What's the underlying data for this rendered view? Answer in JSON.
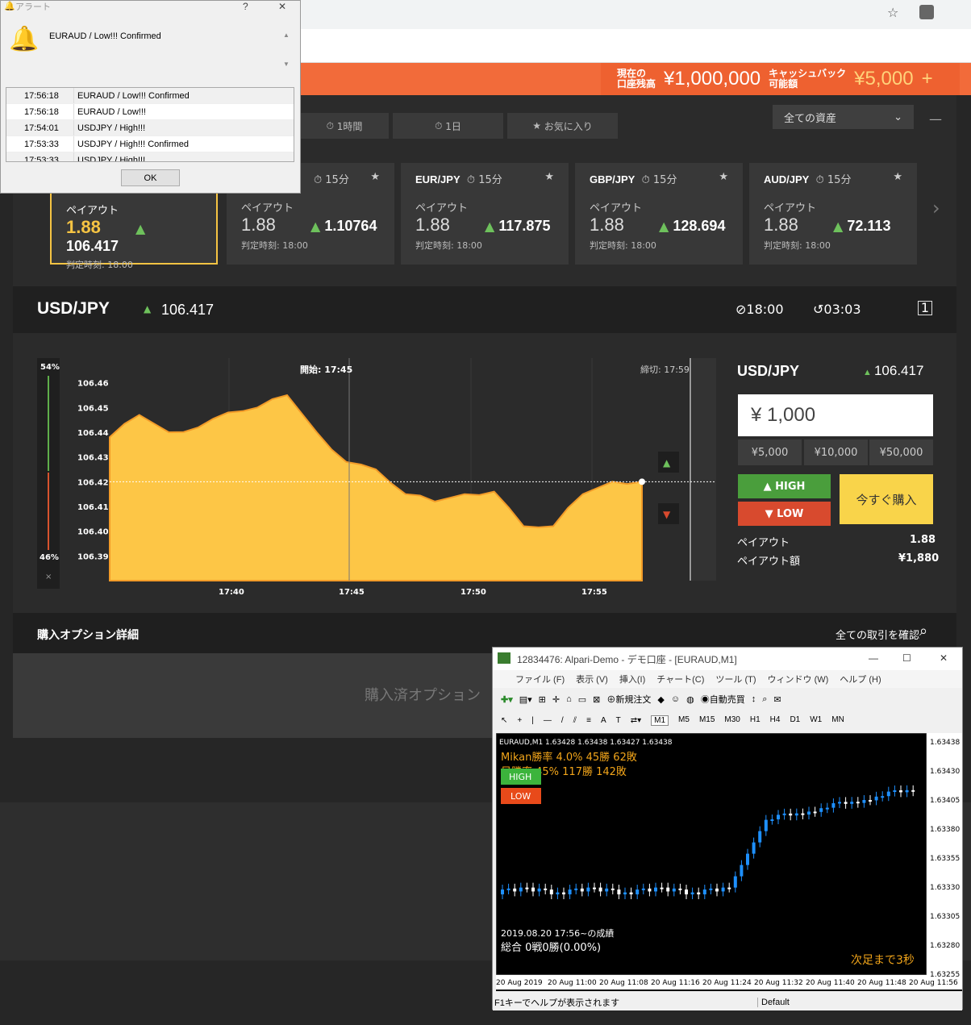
{
  "header": {
    "balance_label": "現在の\n口座残高",
    "balance_value": "¥1,000,000",
    "cashback_label": "キャッシュバック\n可能額",
    "cashback_value": "¥5,000",
    "plus": "+"
  },
  "tabs": [
    "1時間",
    "1日",
    "お気に入り"
  ],
  "asset_select": "全ての資産",
  "cards": [
    {
      "pair": "",
      "period": "15分",
      "payout_label": "ペイアウト",
      "payout": "1.88",
      "price": "106.417",
      "time": "判定時刻: 18:00"
    },
    {
      "pair": "",
      "period": "15分",
      "payout_label": "ペイアウト",
      "payout": "1.88",
      "price": "1.10764",
      "time": "判定時刻: 18:00"
    },
    {
      "pair": "EUR/JPY",
      "period": "15分",
      "payout_label": "ペイアウト",
      "payout": "1.88",
      "price": "117.875",
      "time": "判定時刻: 18:00"
    },
    {
      "pair": "GBP/JPY",
      "period": "15分",
      "payout_label": "ペイアウト",
      "payout": "1.88",
      "price": "128.694",
      "time": "判定時刻: 18:00"
    },
    {
      "pair": "AUD/JPY",
      "period": "15分",
      "payout_label": "ペイアウト",
      "payout": "1.88",
      "price": "72.113",
      "time": "判定時刻: 18:00"
    }
  ],
  "pair_row": {
    "pair": "USD/JPY",
    "price": "106.417",
    "end_time": "18:00",
    "remaining": "03:03"
  },
  "chart": {
    "pct_high": "54%",
    "pct_low": "46%",
    "close": "×",
    "start_label": "開始: 17:45",
    "end_label": "締切: 17:59",
    "yticks": [
      "106.46",
      "106.45",
      "106.44",
      "106.43",
      "106.42",
      "106.41",
      "106.40",
      "106.39"
    ],
    "xticks": [
      "17:40",
      "17:45",
      "17:50",
      "17:55"
    ]
  },
  "chart_data": {
    "type": "area",
    "x": [
      "17:38",
      "17:39",
      "17:40",
      "17:41",
      "17:42",
      "17:43",
      "17:44",
      "17:45",
      "17:46",
      "17:47",
      "17:48",
      "17:49",
      "17:50",
      "17:51",
      "17:52",
      "17:53",
      "17:54",
      "17:55",
      "17:56"
    ],
    "values": [
      106.438,
      106.447,
      106.44,
      106.442,
      106.448,
      106.45,
      106.455,
      106.44,
      106.428,
      106.425,
      106.415,
      106.412,
      106.415,
      106.416,
      106.402,
      106.402,
      106.415,
      106.42,
      106.42
    ],
    "ylim": [
      106.38,
      106.47
    ]
  },
  "side": {
    "pair": "USD/JPY",
    "price": "106.417",
    "amount": "¥ 1,000",
    "quick": [
      "¥5,000",
      "¥10,000",
      "¥50,000"
    ],
    "high": "HIGH",
    "low": "LOW",
    "buy": "今すぐ購入",
    "payout_label": "ペイアウト",
    "payout": "1.88",
    "payout_amount_label": "ペイアウト額",
    "payout_amount": "¥1,880"
  },
  "details": {
    "title": "購入オプション詳細",
    "all_trades": "全ての取引を確認",
    "purchased": "購入済オプション"
  },
  "alert": {
    "title": "アラート",
    "help": "?",
    "close": "✕",
    "message": "EURAUD / Low!!! Confirmed",
    "rows": [
      {
        "time": "17:56:18",
        "msg": "EURAUD / Low!!! Confirmed"
      },
      {
        "time": "17:56:18",
        "msg": "EURAUD / Low!!!"
      },
      {
        "time": "17:54:01",
        "msg": "USDJPY / High!!!"
      },
      {
        "time": "17:53:33",
        "msg": "USDJPY / High!!! Confirmed"
      },
      {
        "time": "17:53:33",
        "msg": "USDJPY / High!!!"
      }
    ],
    "ok": "OK"
  },
  "mt4": {
    "title": "12834476: Alpari-Demo - デモ口座 - [EURAUD,M1]",
    "menu": [
      "ファイル (F)",
      "表示 (V)",
      "挿入(I)",
      "チャート(C)",
      "ツール (T)",
      "ウィンドウ (W)",
      "ヘルプ (H)"
    ],
    "new_order": "新規注文",
    "auto_trade": "自動売買",
    "timeframes": [
      "M1",
      "M5",
      "M15",
      "M30",
      "H1",
      "H4",
      "D1",
      "W1",
      "MN"
    ],
    "chart_header": "EURAUD,M1  1.63428 1.63438 1.63427 1.63438",
    "stat1": "Mikan勝率 4.0%  45勝 62敗",
    "stat2": "日勝率 45%  117勝 142敗",
    "high": "HIGH",
    "low": "LOW",
    "bottom1": "2019.08.20 17:56~の成績",
    "bottom2": "総合 0戦0勝(0.00%)",
    "bottom3": "次足まで3秒",
    "yticks": [
      "1.63438",
      "1.63430",
      "1.63405",
      "1.63380",
      "1.63355",
      "1.63330",
      "1.63305",
      "1.63280",
      "1.63255"
    ],
    "xticks": [
      "20 Aug 2019",
      "20 Aug 11:00",
      "20 Aug 11:08",
      "20 Aug 11:16",
      "20 Aug 11:24",
      "20 Aug 11:32",
      "20 Aug 11:40",
      "20 Aug 11:48",
      "20 Aug 11:56"
    ],
    "status_help": "F1キーでヘルプが表示されます",
    "status_profile": "Default"
  }
}
